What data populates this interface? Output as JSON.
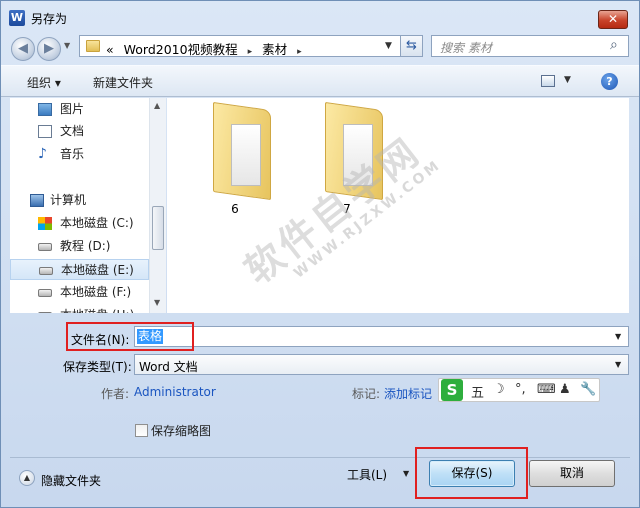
{
  "window": {
    "title": "另存为",
    "app_icon_letter": "W",
    "close_glyph": "✕"
  },
  "address": {
    "overflow": "«",
    "crumbs": [
      "Word2010视频教程",
      "素材"
    ],
    "separator": "▸"
  },
  "search": {
    "placeholder": "搜索 素材"
  },
  "toolbar": {
    "organize_label": "组织 ▾",
    "new_folder_label": "新建文件夹"
  },
  "nav": {
    "items": [
      {
        "label": "图片",
        "icon": "picture-icon"
      },
      {
        "label": "文档",
        "icon": "document-icon"
      },
      {
        "label": "音乐",
        "icon": "music-icon"
      },
      {
        "label": "计算机",
        "icon": "computer-icon"
      },
      {
        "label": "本地磁盘 (C:)",
        "icon": "system-drive-icon"
      },
      {
        "label": "教程 (D:)",
        "icon": "drive-icon"
      },
      {
        "label": "本地磁盘 (E:)",
        "icon": "drive-icon",
        "selected": true
      },
      {
        "label": "本地磁盘 (F:)",
        "icon": "drive-icon"
      },
      {
        "label": "本地磁盘 (H:)",
        "icon": "drive-icon"
      }
    ]
  },
  "files": [
    {
      "name": "6",
      "type": "folder"
    },
    {
      "name": "7",
      "type": "folder"
    }
  ],
  "watermark": {
    "text": "软件自学网",
    "url": "WWW.RJZXW.COM"
  },
  "form": {
    "filename_label": "文件名(N):",
    "filename_value": "表格",
    "filetype_label": "保存类型(T):",
    "filetype_value": "Word 文档",
    "author_label": "作者:",
    "author_value": "Administrator",
    "tags_label": "标记:",
    "tags_value": "添加标记",
    "thumbnail_label": "保存缩略图"
  },
  "ime": {
    "logo": "S",
    "glyphs": [
      "五",
      "☽",
      "°,",
      "⌨",
      "♟",
      "🔧"
    ]
  },
  "footer": {
    "hide_folders_label": "隐藏文件夹",
    "tools_label": "工具(L)",
    "save_label": "保存(S)",
    "cancel_label": "取消"
  },
  "colors": {
    "highlight_box": "#e02020",
    "selection": "#3399ff",
    "link": "#1a55c0"
  }
}
